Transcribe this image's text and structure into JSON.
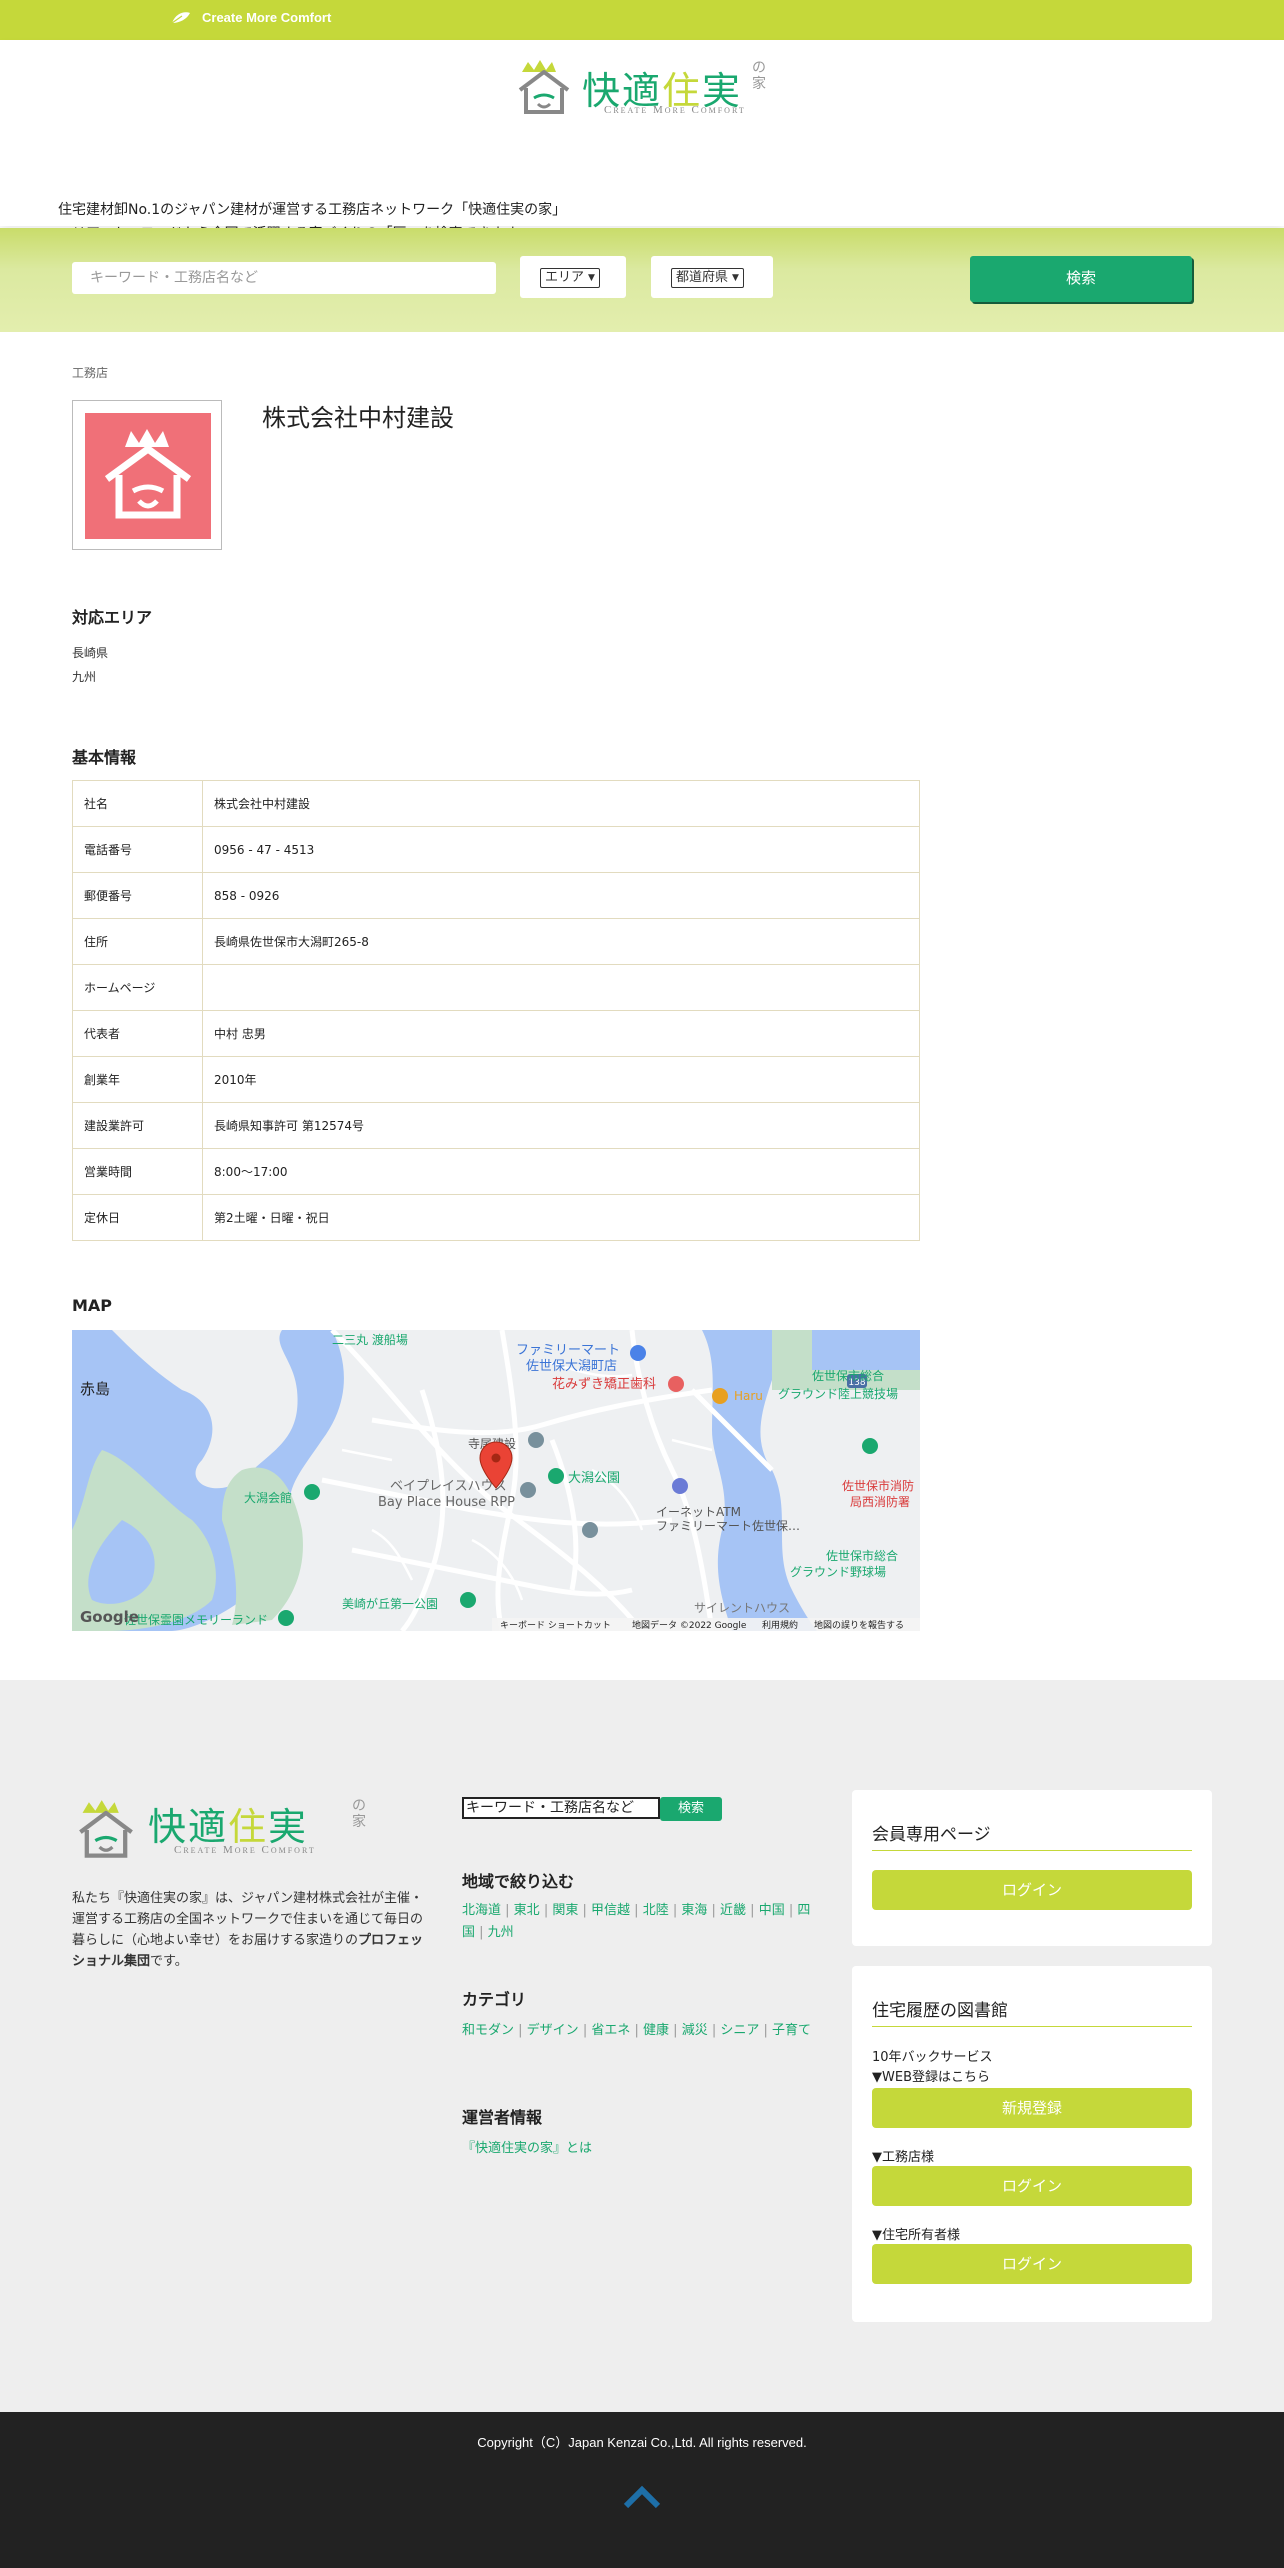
{
  "topbar": {
    "tagline": "Create More Comfort"
  },
  "brand": {
    "chars": [
      "快",
      "適",
      "住",
      "実"
    ],
    "suffix": "の家",
    "sub": "Create More Comfort",
    "colors": {
      "green": "#1aa86f",
      "lime": "#c5d83a",
      "coral": "#f07078"
    }
  },
  "intro": {
    "line1": "住宅建材卸No.1のジャパン建材が運営する工務店ネットワーク「快適住実の家」",
    "line2": "エリア、キーワードから全国で活躍する家づくりの「匠」を検索できます。"
  },
  "search": {
    "placeholder": "キーワード・工務店名など",
    "area_select": "エリア",
    "pref_select": "都道府県",
    "button": "検索"
  },
  "breadcrumb": "工務店",
  "company": {
    "name": "株式会社中村建設"
  },
  "areas": {
    "title": "対応エリア",
    "items": [
      "長崎県",
      "九州"
    ]
  },
  "basic": {
    "title": "基本情報",
    "rows": [
      {
        "k": "社名",
        "v": "株式会社中村建設"
      },
      {
        "k": "電話番号",
        "v": "0956 - 47 - 4513"
      },
      {
        "k": "郵便番号",
        "v": "858 - 0926"
      },
      {
        "k": "住所",
        "v": "長崎県佐世保市大潟町265-8"
      },
      {
        "k": "ホームページ",
        "v": ""
      },
      {
        "k": "代表者",
        "v": "中村 忠男"
      },
      {
        "k": "創業年",
        "v": "2010年"
      },
      {
        "k": "建設業許可",
        "v": "長崎県知事許可 第12574号"
      },
      {
        "k": "営業時間",
        "v": "8:00〜17:00"
      },
      {
        "k": "定休日",
        "v": "第2土曜・日曜・祝日"
      }
    ]
  },
  "map": {
    "title": "MAP",
    "labels": {
      "akashima": "赤島",
      "familymart": "ファミリーマート",
      "familymart2": "佐世保大潟町店",
      "dental": "花みずき矯正歯科",
      "haru": "Haru",
      "sports1": "佐世保市総合",
      "sports2": "グラウンド陸上競技場",
      "fire1": "佐世保市消防",
      "fire2": "局西消防署",
      "terao": "寺尾建設",
      "park": "大潟公園",
      "bayplace1": "ベイプレイスハウス",
      "bayplace2": "Bay Place House RPP",
      "ohgata_hall": "大潟会館",
      "atm1": "イーネットATM",
      "atm2": "ファミリーマート佐世保…",
      "baseball1": "佐世保市総合",
      "baseball2": "グラウンド野球場",
      "misaki_park": "美崎が丘第一公園",
      "memorial": "佐世保霊園メモリーランド",
      "silent": "サイレントハウス",
      "nisanmaru": "二三丸 渡船場",
      "route": "138",
      "google": "Google",
      "attr_keys": "キーボード ショートカット",
      "attr_data": "地図データ ©2022 Google",
      "attr_terms": "利用規約",
      "attr_report": "地図の誤りを報告する"
    }
  },
  "footer": {
    "desc_prefix": "私たち『快適住実の家』は、ジャパン建材株式会社が主催・運営する工務店の全国ネットワークで住まいを通じて毎日の暮らしに（心地よい幸せ）をお届けする家造りの",
    "desc_bold": "プロフェッショナル集団",
    "desc_suffix": "です。",
    "search_value": "キーワード・工務店名など",
    "search_button": "検索",
    "region_title": "地域で絞り込む",
    "regions": [
      "北海道",
      "東北",
      "関東",
      "甲信越",
      "北陸",
      "東海",
      "近畿",
      "中国",
      "四国",
      "九州"
    ],
    "category_title": "カテゴリ",
    "categories": [
      "和モダン",
      "デザイン",
      "省エネ",
      "健康",
      "減災",
      "シニア",
      "子育て"
    ],
    "operator_title": "運営者情報",
    "operator_link": "『快適住実の家』とは",
    "members": {
      "title": "会員専用ページ",
      "login": "ログイン"
    },
    "library": {
      "title": "住宅履歴の図書館",
      "service": "10年バックサービス",
      "web_reg": "▼WEB登録はこちら",
      "register": "新規登録",
      "builder": "▼工務店様",
      "builder_login": "ログイン",
      "owner": "▼住宅所有者様",
      "owner_login": "ログイン"
    },
    "copyright": "Copyright（C）Japan Kenzai Co.,Ltd. All rights reserved."
  }
}
